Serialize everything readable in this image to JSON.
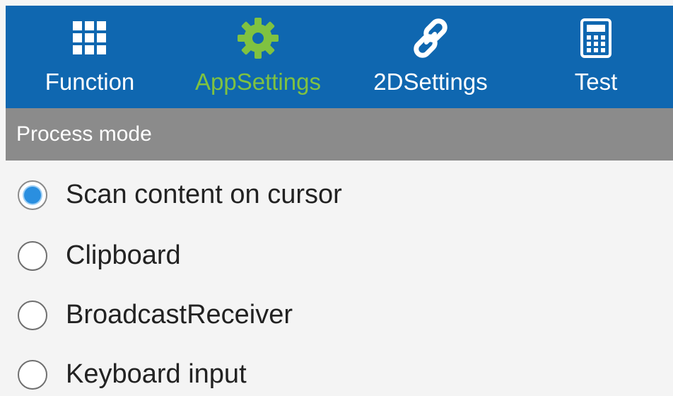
{
  "tabs": [
    {
      "label": "Function",
      "icon": "grid-icon",
      "active": false
    },
    {
      "label": "AppSettings",
      "icon": "gear-icon",
      "active": true
    },
    {
      "label": "2DSettings",
      "icon": "link-icon",
      "active": false
    },
    {
      "label": "Test",
      "icon": "calculator-icon",
      "active": false
    }
  ],
  "section": {
    "title": "Process mode"
  },
  "options": [
    {
      "label": "Scan content on cursor",
      "selected": true
    },
    {
      "label": "Clipboard",
      "selected": false
    },
    {
      "label": "BroadcastReceiver",
      "selected": false
    },
    {
      "label": "Keyboard input",
      "selected": false
    }
  ],
  "colors": {
    "tabbar_bg": "#0f67b0",
    "active_tab": "#7fc241",
    "section_header_bg": "#8b8b8b",
    "radio_selected": "#2a8fe0"
  }
}
